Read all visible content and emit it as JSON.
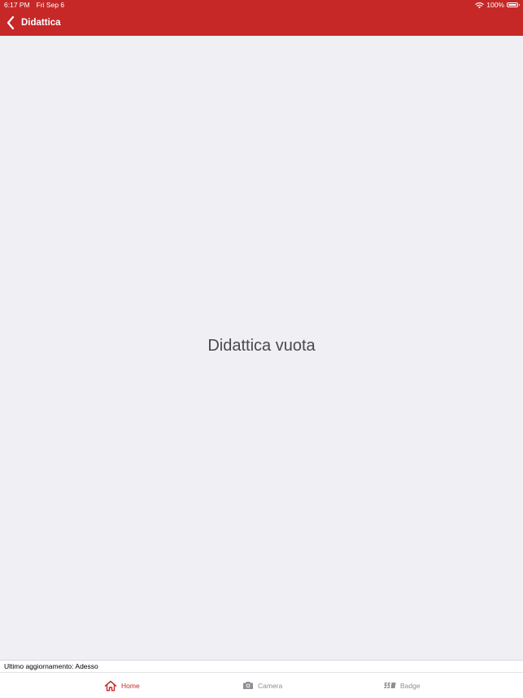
{
  "status_bar": {
    "time": "6:17 PM",
    "date": "Fri Sep 6",
    "battery_text": "100%",
    "battery_level": 1.0
  },
  "nav": {
    "title": "Didattica",
    "back_icon": "chevron-left-icon"
  },
  "main": {
    "empty_message": "Didattica vuota"
  },
  "footer": {
    "last_update": "Ultimo aggiornamento: Adesso"
  },
  "tabs": [
    {
      "label": "Home",
      "icon": "house-icon",
      "active": true
    },
    {
      "label": "Camera",
      "icon": "camera-icon",
      "active": false
    },
    {
      "label": "Badge",
      "icon": "badge-icon",
      "active": false
    }
  ],
  "colors": {
    "brand": "#c62828",
    "background": "#efeff4",
    "inactive": "#8e8e93"
  }
}
